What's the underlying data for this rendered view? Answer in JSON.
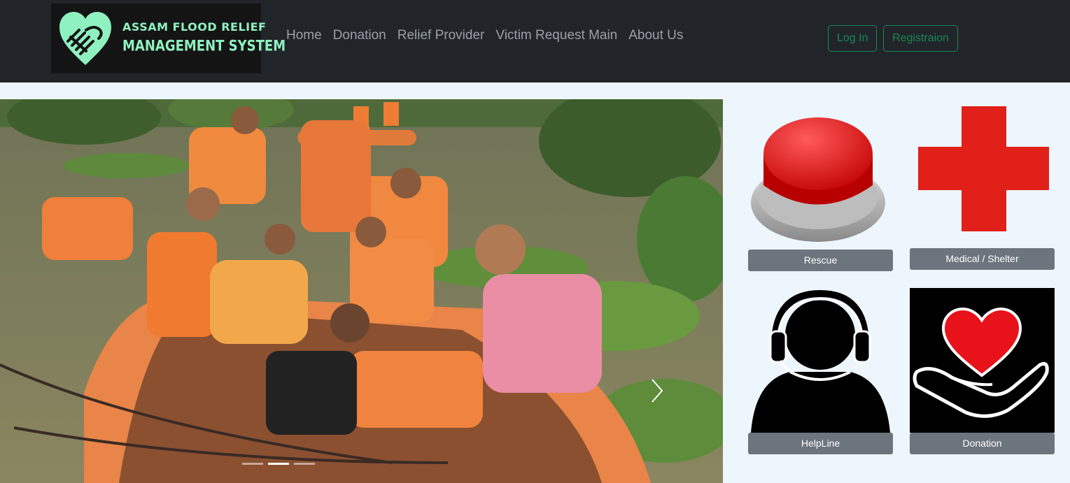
{
  "brand": {
    "line1": "ASSAM FLOOD RELIEF",
    "line2": "MANAGEMENT SYSTEM",
    "logo_icon": "heart-hand-icon"
  },
  "nav": {
    "items": [
      {
        "label": "Home"
      },
      {
        "label": "Donation"
      },
      {
        "label": "Relief Provider"
      },
      {
        "label": "Victim Request Main"
      },
      {
        "label": "About Us"
      }
    ]
  },
  "auth": {
    "login_label": "Log In",
    "register_label": "Registraion"
  },
  "carousel": {
    "slide_count": 3,
    "active_index": 1,
    "next_icon": "chevron-right-icon"
  },
  "tiles": [
    {
      "label": "Rescue",
      "icon": "red-button-icon"
    },
    {
      "label": "Medical / Shelter",
      "icon": "red-cross-icon"
    },
    {
      "label": "HelpLine",
      "icon": "headset-person-icon"
    },
    {
      "label": "Donation",
      "icon": "heart-in-hand-icon"
    }
  ],
  "colors": {
    "navbar": "#212529",
    "accent_green": "#198754",
    "brand_mint": "#8ff0c0",
    "tile_button": "#6c757d",
    "page_bg": "#eef6fd"
  }
}
